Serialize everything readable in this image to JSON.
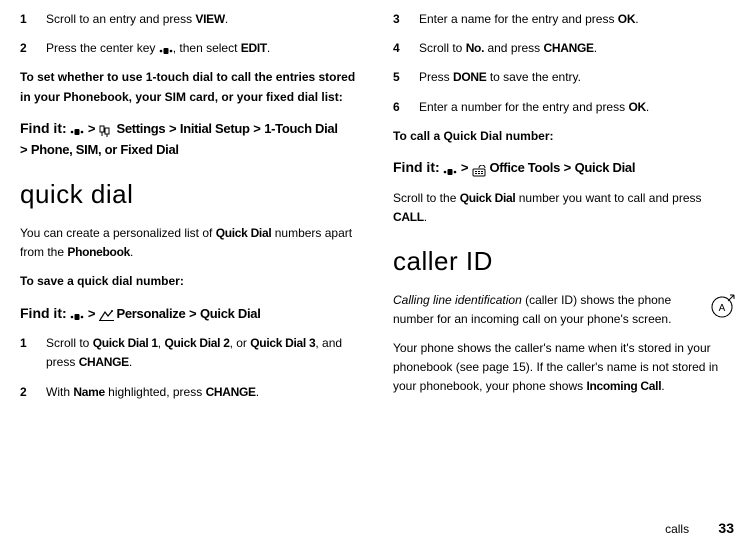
{
  "left": {
    "step1": {
      "num": "1",
      "pre": "Scroll to an entry and press ",
      "view": "VIEW",
      "post": "."
    },
    "step2a": {
      "num": "2",
      "pre": "Press the center key "
    },
    "step2b": ", then select ",
    "step2edit": "EDIT",
    "step2post": ".",
    "subhead": "To set whether to use 1-touch dial to call the entries stored in your Phonebook, your SIM card, or your fixed dial list",
    "subhead_colon": ":",
    "findit_lbl": "Find it:",
    "path1": {
      "settings": "Settings",
      "gt": ">",
      "initial": "Initial Setup",
      "onetouch": "1-Touch Dial",
      "last": "Phone, SIM, or Fixed Dial"
    },
    "h_quick": "quick dial",
    "quick_p1a": "You can create a personalized list of ",
    "quick_p1b": "Quick Dial",
    "quick_p1c": " numbers apart from the ",
    "quick_p1d": "Phonebook",
    "quick_p1e": ".",
    "save_sub": "To save a quick dial number",
    "path2": {
      "personalize": "Personalize",
      "quick": "Quick Dial"
    },
    "q1": {
      "num": "1",
      "a": "Scroll to ",
      "qd1": "Quick Dial 1",
      "c1": ", ",
      "qd2": "Quick Dial 2",
      "c2": ", or ",
      "qd3": "Quick Dial 3",
      "d": ", and press ",
      "change": "CHANGE",
      "e": "."
    },
    "q2": {
      "num": "2",
      "a": "With ",
      "name": "Name",
      "b": " highlighted, press ",
      "change": "CHANGE",
      "c": "."
    }
  },
  "right": {
    "s3": {
      "num": "3",
      "a": "Enter a name for the entry and press ",
      "ok": "OK",
      "b": "."
    },
    "s4": {
      "num": "4",
      "a": "Scroll to ",
      "no": "No.",
      "b": " and press ",
      "change": "CHANGE",
      "c": "."
    },
    "s5": {
      "num": "5",
      "a": "Press ",
      "done": "DONE",
      "b": " to save the entry."
    },
    "s6": {
      "num": "6",
      "a": "Enter a number for the entry and press ",
      "ok": "OK",
      "b": "."
    },
    "call_sub": "To call a Quick Dial number",
    "findit_lbl": "Find it:",
    "path3": {
      "office": "Office Tools",
      "quick": "Quick Dial"
    },
    "scr_a": "Scroll to the ",
    "scr_b": "Quick Dial",
    "scr_c": " number you want to call and press ",
    "scr_d": "CALL",
    "scr_e": ".",
    "h_caller": "caller ID",
    "cid_a": "Calling line identification",
    "cid_b": " (caller ID) shows the phone number for an incoming call on your phone's screen.",
    "cid2_a": "Your phone shows the caller's name when it's stored in your phonebook (see page 15). If the caller's name is not stored in your phonebook, your phone shows ",
    "cid2_b": "Incoming Call",
    "cid2_c": "."
  },
  "footer": {
    "label": "calls",
    "page": "33"
  }
}
